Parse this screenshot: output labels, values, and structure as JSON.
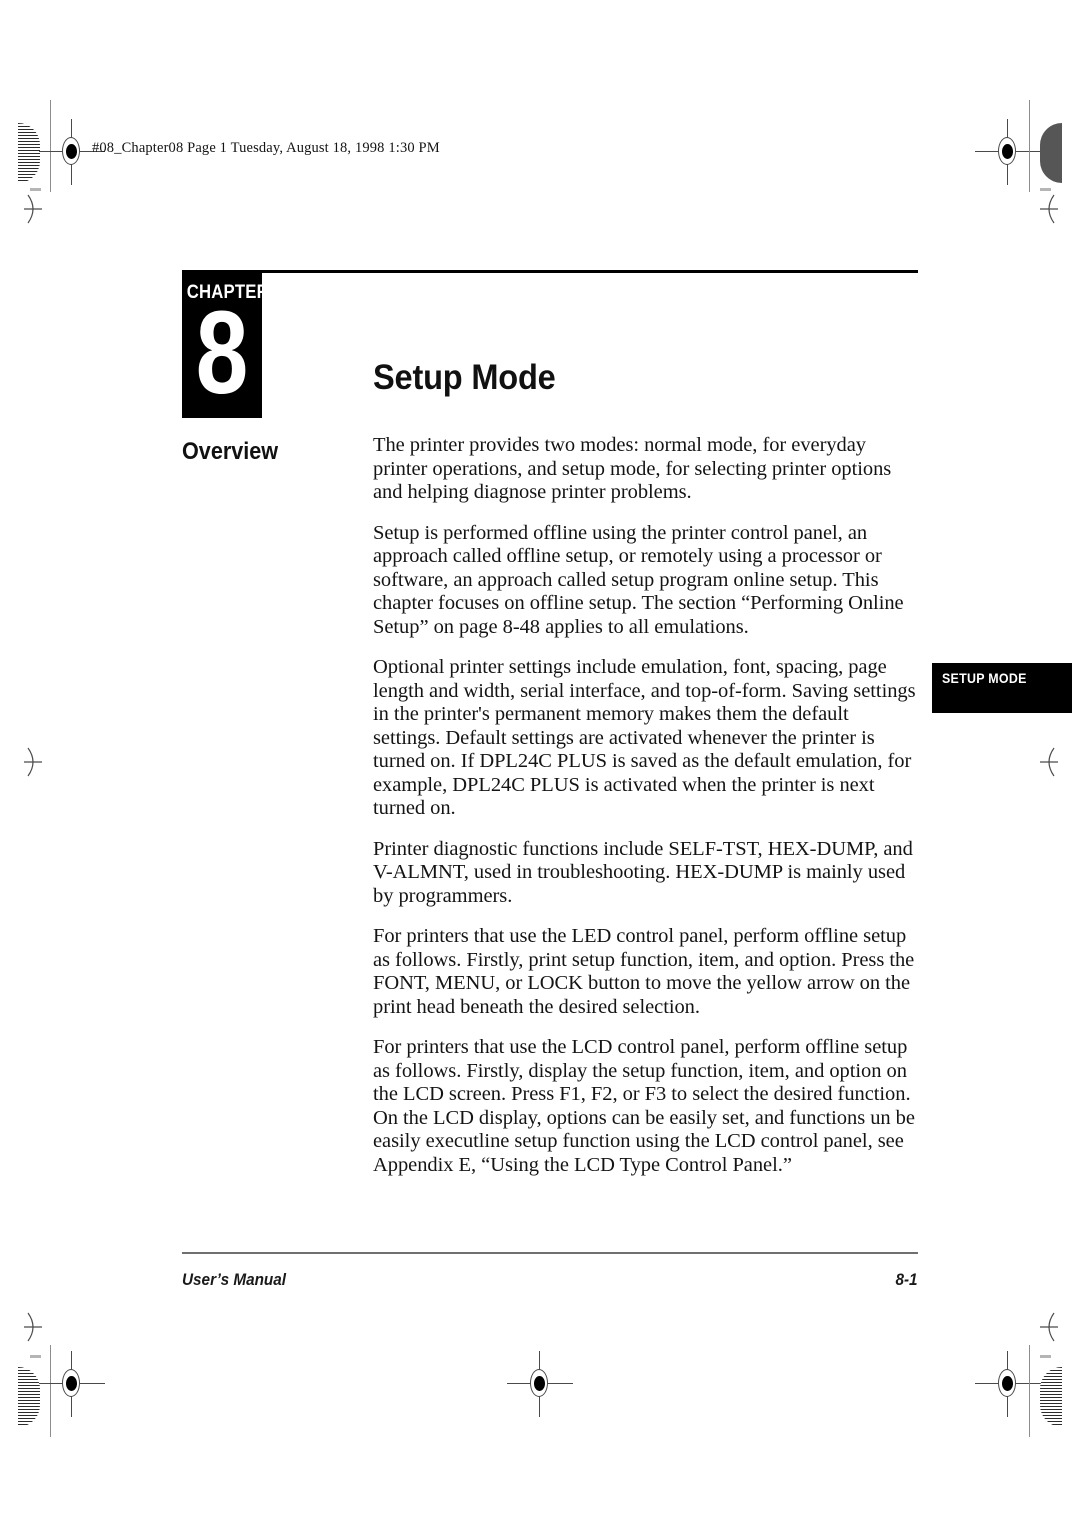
{
  "page": {
    "file_header": "#08_Chapter08  Page 1  Tuesday, August 18, 1998  1:30 PM",
    "chapter_kicker": "CHAPTER",
    "chapter_number": "8",
    "title": "Setup Mode",
    "section_heading": "Overview",
    "side_tab_label": "SETUP MODE",
    "footer_left": "User’s Manual",
    "footer_right": "8-1"
  },
  "body": {
    "paragraphs": [
      "The printer provides two modes: normal mode, for everyday printer operations, and setup mode, for selecting printer options and helping diagnose printer problems.",
      "Setup is performed offline using the printer control panel, an approach called offline setup, or remotely using a processor or software, an approach called setup program online setup. This chapter focuses on offline setup. The section “Performing Online Setup” on page 8-48 applies to all emulations.",
      "Optional printer settings include emulation, font, spacing, page length and width, serial interface, and top-of-form. Saving settings in the printer's permanent memory makes them the default settings. Default settings are activated whenever the printer is turned on. If DPL24C PLUS is saved as the default emulation, for example, DPL24C PLUS is activated when the printer is next turned on.",
      "Printer diagnostic functions include SELF-TST, HEX-DUMP, and V-ALMNT, used in troubleshooting. HEX-DUMP is mainly used by programmers.",
      "For printers that use the LED control panel, perform offline setup as follows. Firstly, print setup function, item, and option. Press the FONT, MENU, or LOCK button to move the yellow arrow on the print head beneath the desired selection.",
      "For printers that use the LCD control panel, perform offline setup as follows. Firstly, display the setup function, item, and option on the LCD screen. Press F1, F2, or F3 to select the desired function. On the LCD display, options can be easily set, and functions un be easily executline setup function using the LCD control panel, see Appendix E, “Using the LCD Type Control Panel.”"
    ]
  },
  "colors": {
    "ink": "#141414",
    "black_block": "#000000",
    "footer_rule": "#6f6f6f",
    "registration_gray": "#4a4a4a"
  }
}
